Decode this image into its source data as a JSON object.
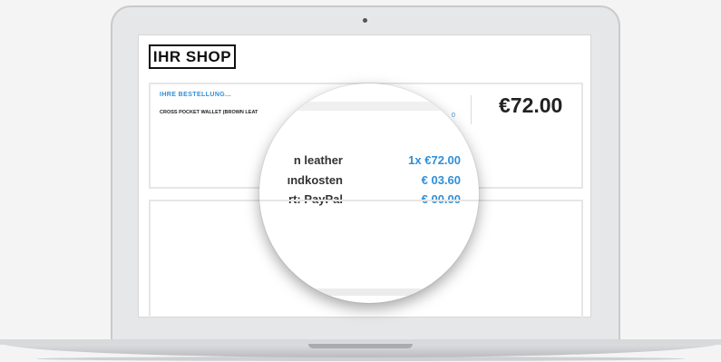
{
  "shop": {
    "logo": "IHR SHOP"
  },
  "order": {
    "title": "IHRE BESTELLUNG...",
    "item": "CROSS POCKET WALLET (BROWN LEAT",
    "total": "€72.00",
    "partial_price": "0"
  },
  "magnifier": {
    "rows": [
      {
        "label": "n leather",
        "value": "1x €72.00"
      },
      {
        "label": "ındkosten",
        "value": "€ 03.60"
      },
      {
        "label": "rt: PayPal",
        "value": "€ 00.00"
      }
    ]
  },
  "colors": {
    "accent": "#2f8fd8",
    "text": "#222222",
    "border": "#e6e6e6"
  }
}
